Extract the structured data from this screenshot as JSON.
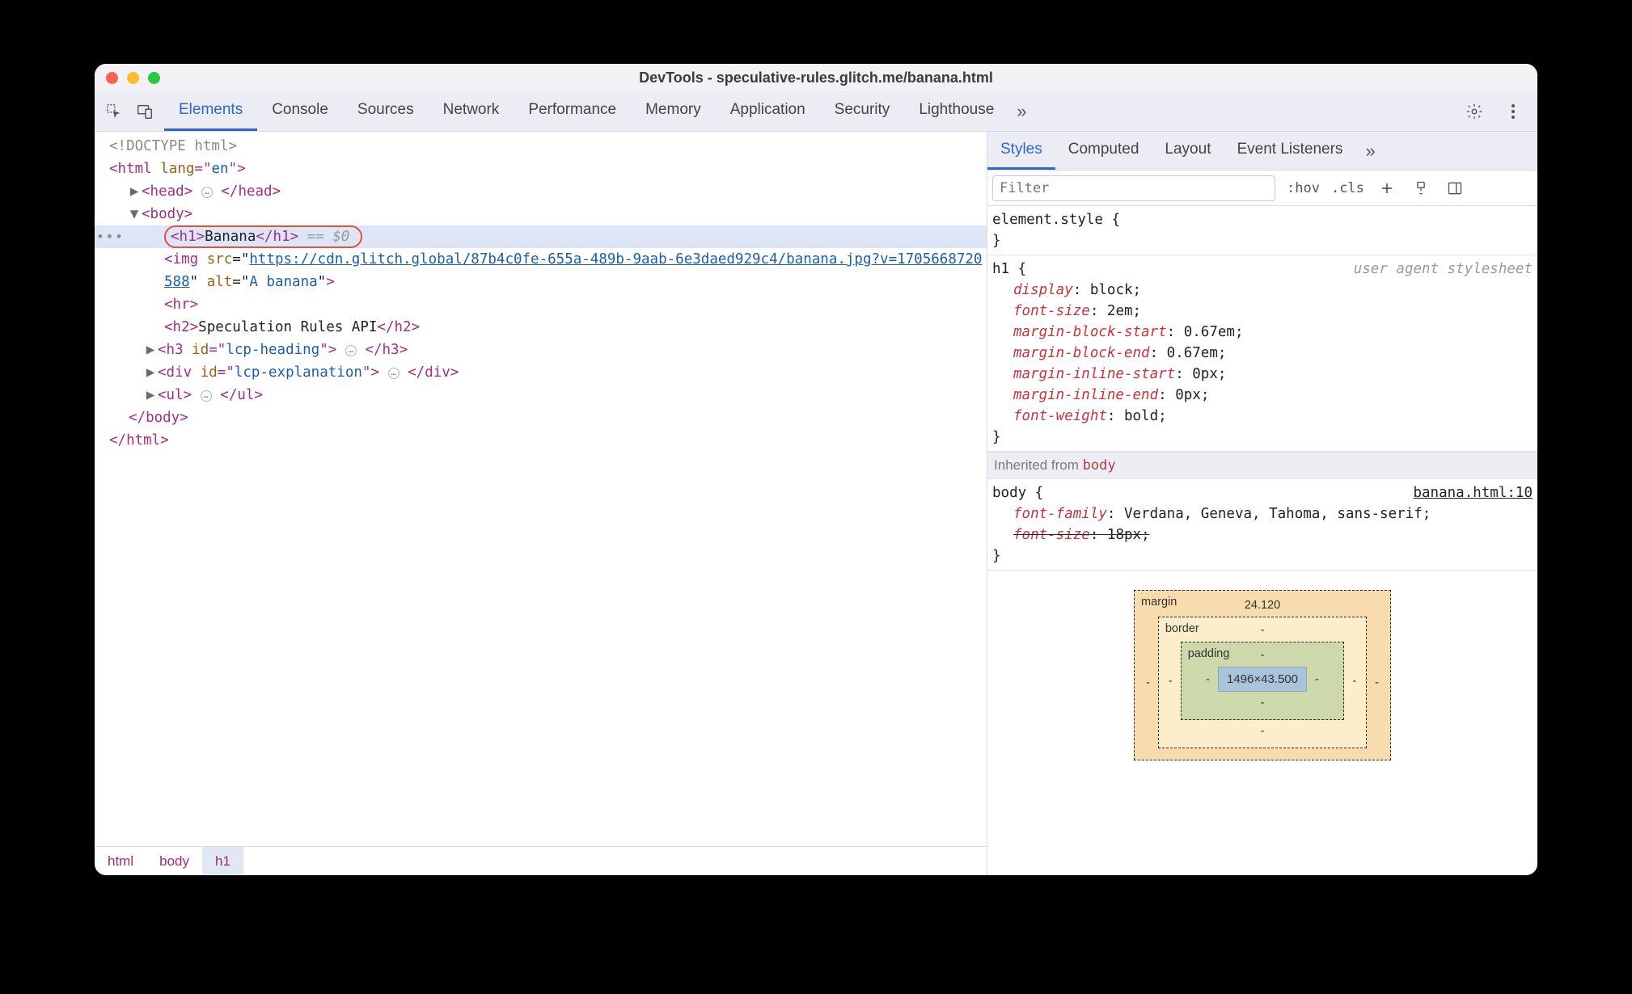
{
  "window": {
    "title": "DevTools - speculative-rules.glitch.me/banana.html"
  },
  "mainTabs": {
    "items": [
      "Elements",
      "Console",
      "Sources",
      "Network",
      "Performance",
      "Memory",
      "Application",
      "Security",
      "Lighthouse"
    ],
    "active": 0,
    "more": "»"
  },
  "dom": {
    "doctype": "<!DOCTYPE html>",
    "htmlOpen": {
      "tag": "html",
      "attrName": "lang",
      "attrVal": "en"
    },
    "head": {
      "tag": "head"
    },
    "body": {
      "tag": "body"
    },
    "h1": {
      "open": "<h1>",
      "text": "Banana",
      "close": "</h1>",
      "eq": " == $0"
    },
    "img": {
      "prefix": "<img ",
      "srcName": "src",
      "srcUrl1": "https://cdn.glitch.global/87b4c0fe-655a-489b-9aab-6e3daed929c4/ba",
      "srcUrl2": "nana.jpg?v=1705668720588",
      "altName": "alt",
      "altVal": "A banana",
      "suffix": ">"
    },
    "hr": "<hr>",
    "h2": {
      "open": "<h2>",
      "text": "Speculation Rules API",
      "close": "</h2>"
    },
    "h3": {
      "tag": "h3",
      "idName": "id",
      "idVal": "lcp-heading"
    },
    "div": {
      "tag": "div",
      "idName": "id",
      "idVal": "lcp-explanation"
    },
    "ul": {
      "tag": "ul"
    },
    "bodyClose": "</body>",
    "htmlClose": "</html>",
    "ellipsis": "…"
  },
  "crumbs": {
    "items": [
      "html",
      "body",
      "h1"
    ],
    "selected": 2
  },
  "stylesTabs": {
    "items": [
      "Styles",
      "Computed",
      "Layout",
      "Event Listeners"
    ],
    "active": 0,
    "more": "»"
  },
  "stylesToolbar": {
    "filterPlaceholder": "Filter",
    "hov": ":hov",
    "cls": ".cls"
  },
  "rules": {
    "elementStyle": {
      "sel": "element.style",
      "open": " {",
      "close": "}"
    },
    "h1": {
      "sel": "h1 {",
      "ua": "user agent stylesheet",
      "decls": [
        {
          "p": "display",
          "v": "block"
        },
        {
          "p": "font-size",
          "v": "2em"
        },
        {
          "p": "margin-block-start",
          "v": "0.67em"
        },
        {
          "p": "margin-block-end",
          "v": "0.67em"
        },
        {
          "p": "margin-inline-start",
          "v": "0px"
        },
        {
          "p": "margin-inline-end",
          "v": "0px"
        },
        {
          "p": "font-weight",
          "v": "bold"
        }
      ],
      "close": "}"
    },
    "inheritedLabel": "Inherited from ",
    "inheritedFrom": "body",
    "body": {
      "sel": "body {",
      "link": "banana.html:10",
      "decls": [
        {
          "p": "font-family",
          "v": "Verdana, Geneva, Tahoma, sans-serif",
          "strike": false
        },
        {
          "p": "font-size",
          "v": "18px",
          "strike": true
        }
      ],
      "close": "}"
    }
  },
  "boxModel": {
    "marginLabel": "margin",
    "marginTop": "24.120",
    "borderLabel": "border",
    "borderTop": "-",
    "paddingLabel": "padding",
    "paddingTop": "-",
    "content": "1496×43.500",
    "dash": "-"
  }
}
